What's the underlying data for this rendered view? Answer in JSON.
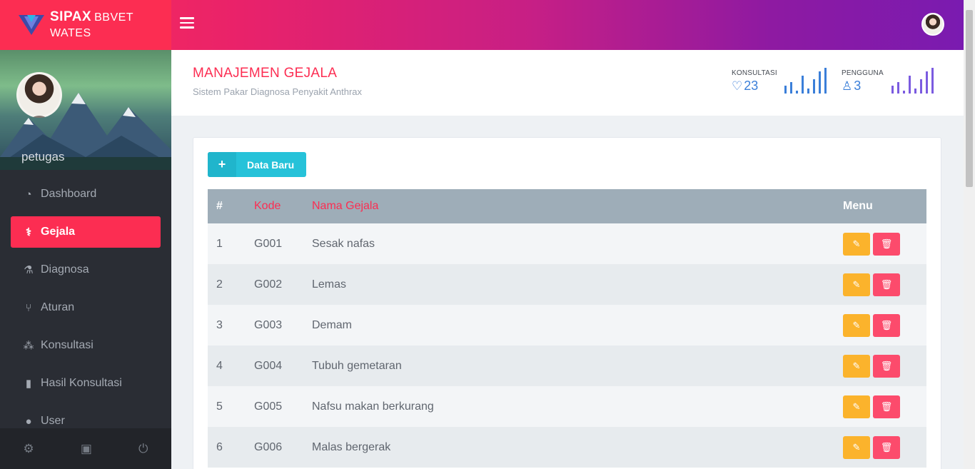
{
  "app": {
    "brand_bold": "SIPAX",
    "brand_rest": "BBVET WATES"
  },
  "icons": {
    "logo": "v-logo-icon",
    "menu": "hamburger-icon",
    "heart": "heart-icon",
    "user": "user-icon",
    "dashboard": "gauge-icon",
    "gejala": "medical-kit-icon",
    "diagnosa": "flask-icon",
    "aturan": "branch-icon",
    "konsultasi": "network-icon",
    "hasil": "book-icon",
    "user_menu": "person-icon",
    "settings": "gear-icon",
    "monitor": "monitor-icon",
    "power": "power-icon",
    "plus": "plus-icon",
    "edit": "pencil-icon",
    "delete": "trash-icon"
  },
  "sidebar": {
    "profile_name": "petugas",
    "items": [
      {
        "label": "Dashboard",
        "icon": "dashboard-icon"
      },
      {
        "label": "Gejala",
        "icon": "medical-kit-icon"
      },
      {
        "label": "Diagnosa",
        "icon": "flask-icon"
      },
      {
        "label": "Aturan",
        "icon": "branch-icon"
      },
      {
        "label": "Konsultasi",
        "icon": "network-icon"
      },
      {
        "label": "Hasil Konsultasi",
        "icon": "book-icon"
      },
      {
        "label": "User",
        "icon": "person-icon"
      }
    ]
  },
  "header": {
    "title": "MANAJEMEN GEJALA",
    "subtitle": "Sistem Pakar Diagnosa Penyakit Anthrax",
    "stats": [
      {
        "label": "KONSULTASI",
        "value": "23",
        "color": "#3b7fd9"
      },
      {
        "label": "PENGGUNA",
        "value": "3",
        "color": "#3b7fd9"
      }
    ],
    "sparks": {
      "konsultasi": [
        0.3,
        0.45,
        0.1,
        0.7,
        0.2,
        0.55,
        0.85,
        1.0
      ],
      "pengguna": [
        0.3,
        0.45,
        0.1,
        0.7,
        0.2,
        0.55,
        0.85,
        1.0
      ]
    }
  },
  "content": {
    "new_button": "Data Baru",
    "table": {
      "headers": [
        "#",
        "Kode",
        "Nama Gejala",
        "Menu"
      ],
      "rows": [
        {
          "no": "1",
          "kode": "G001",
          "nama": "Sesak nafas"
        },
        {
          "no": "2",
          "kode": "G002",
          "nama": "Lemas"
        },
        {
          "no": "3",
          "kode": "G003",
          "nama": "Demam"
        },
        {
          "no": "4",
          "kode": "G004",
          "nama": "Tubuh gemetaran"
        },
        {
          "no": "5",
          "kode": "G005",
          "nama": "Nafsu makan berkurang"
        },
        {
          "no": "6",
          "kode": "G006",
          "nama": "Malas bergerak"
        }
      ]
    }
  },
  "colors": {
    "accent": "#fc2d52",
    "info": "#26c2d9",
    "warning": "#fbb32c",
    "danger": "#fc4b6c"
  }
}
